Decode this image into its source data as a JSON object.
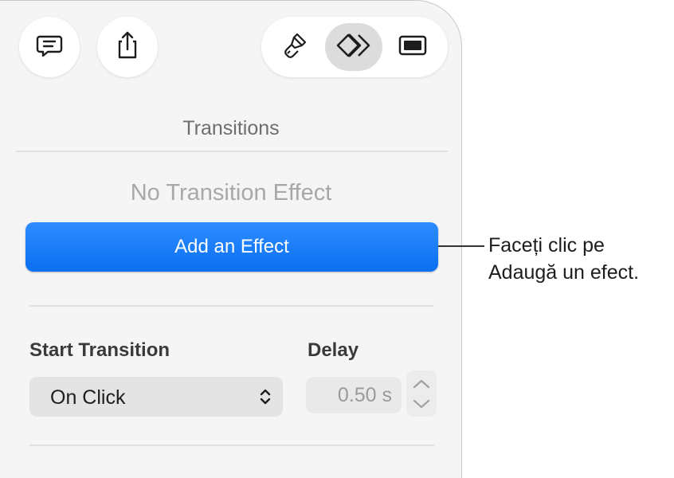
{
  "toolbar": {
    "comment_icon": "comment-icon",
    "share_icon": "share-icon",
    "tabs": [
      {
        "name": "format",
        "icon": "paintbrush-icon",
        "selected": false
      },
      {
        "name": "animate",
        "icon": "animate-diamonds-icon",
        "selected": true
      },
      {
        "name": "document",
        "icon": "document-icon",
        "selected": false
      }
    ]
  },
  "panel": {
    "title": "Transitions",
    "empty_state": "No Transition Effect",
    "add_button_label": "Add an Effect",
    "start_transition": {
      "label": "Start Transition",
      "value": "On Click"
    },
    "delay": {
      "label": "Delay",
      "value": "0.50 s"
    }
  },
  "callout": {
    "line1": "Faceți clic pe",
    "line2": "Adaugă un efect."
  },
  "colors": {
    "accent": "#0a70f0",
    "panel_background": "#f5f5f5",
    "selected_tab": "#dcdcdc"
  }
}
